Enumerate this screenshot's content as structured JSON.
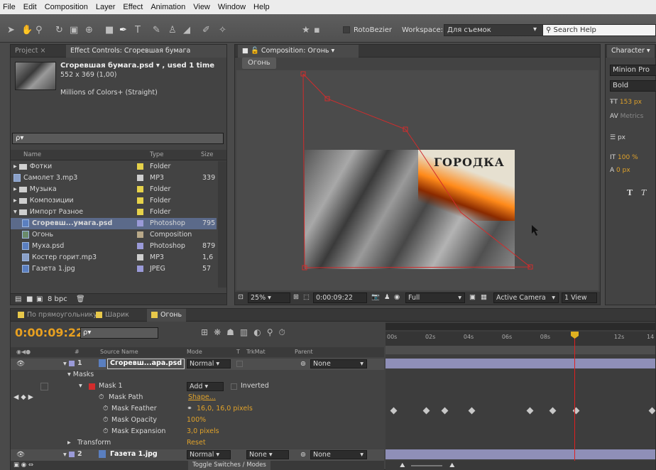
{
  "menu": [
    "File",
    "Edit",
    "Composition",
    "Layer",
    "Effect",
    "Animation",
    "View",
    "Window",
    "Help"
  ],
  "toolbar": {
    "rotobezier": "RotoBezier",
    "workspace_label": "Workspace:",
    "workspace_value": "Для съемок",
    "search_placeholder": "Search Help"
  },
  "project": {
    "tab_project": "Project",
    "tab_effects": "Effect Controls: Сгоревшая бумага",
    "asset_name": "Сгоревшая бумага.psd ▾ , used 1 time",
    "asset_dims": "552 x 369 (1,00)",
    "asset_colors": "Millions of Colors+ (Straight)",
    "search_placeholder": "ρ▾",
    "col_name": "Name",
    "col_type": "Type",
    "col_size": "Size",
    "rows": [
      {
        "name": "Фотки",
        "type": "Folder",
        "size": "",
        "icon": "folder",
        "swatch": "#e6d24a",
        "indent": 0
      },
      {
        "name": "Самолет 3.mp3",
        "type": "MP3",
        "size": "339",
        "icon": "audio",
        "swatch": "#cfcfcf",
        "indent": 0
      },
      {
        "name": "Музыка",
        "type": "Folder",
        "size": "",
        "icon": "folder",
        "swatch": "#e6d24a",
        "indent": 0
      },
      {
        "name": "Композиции",
        "type": "Folder",
        "size": "",
        "icon": "folder",
        "swatch": "#e6d24a",
        "indent": 0
      },
      {
        "name": "Импорт Разное",
        "type": "Folder",
        "size": "",
        "icon": "folder",
        "swatch": "#e6d24a",
        "indent": 0
      },
      {
        "name": "Сгоревш...умага.psd",
        "type": "Photoshop",
        "size": "795",
        "icon": "psd",
        "swatch": "#9a9ad8",
        "indent": 1
      },
      {
        "name": "Огонь",
        "type": "Composition",
        "size": "",
        "icon": "comp",
        "swatch": "#b8a888",
        "indent": 1
      },
      {
        "name": "Муха.psd",
        "type": "Photoshop",
        "size": "879",
        "icon": "psd",
        "swatch": "#9a9ad8",
        "indent": 1
      },
      {
        "name": "Костер горит.mp3",
        "type": "MP3",
        "size": "1,6",
        "icon": "audio",
        "swatch": "#cfcfcf",
        "indent": 1
      },
      {
        "name": "Газета 1.jpg",
        "type": "JPEG",
        "size": "57",
        "icon": "jpg",
        "swatch": "#9a9ad8",
        "indent": 1
      }
    ],
    "bpc": "8 bpc"
  },
  "comp": {
    "tab": "Composition: Огонь",
    "label": "Огонь",
    "image_text": "ГОРОДКА",
    "zoom": "25%",
    "timecode": "0:00:09:22",
    "resolution": "Full",
    "camera": "Active Camera",
    "views": "1 View"
  },
  "character": {
    "tab": "Character",
    "font": "Minion Pro",
    "style": "Bold",
    "size": "153 px",
    "metrics": "Metrics",
    "leading": "px",
    "scale": "100 %",
    "baseline": "0 px"
  },
  "timeline": {
    "tabs": [
      "По прямоугольнику",
      "Шарик",
      "Огонь"
    ],
    "timecode": "0:00:09:22",
    "search_placeholder": "ρ▾",
    "col_hash": "#",
    "col_source": "Source Name",
    "col_mode": "Mode",
    "col_t": "T",
    "col_trkmat": "TrkMat",
    "col_parent": "Parent",
    "layer1": {
      "num": "1",
      "name": "Сгоревш...ара.psd",
      "mode": "Normal",
      "parent": "None"
    },
    "masks": "Masks",
    "mask1": "Mask 1",
    "mask1_mode": "Add",
    "inverted": "Inverted",
    "mask_path": "Mask Path",
    "mask_path_val": "Shape...",
    "mask_feather": "Mask Feather",
    "mask_feather_val": "16,0, 16,0 pixels",
    "mask_opacity": "Mask Opacity",
    "mask_opacity_val": "100%",
    "mask_expansion": "Mask Expansion",
    "mask_expansion_val": "3,0 pixels",
    "transform": "Transform",
    "transform_val": "Reset",
    "layer2": {
      "num": "2",
      "name": "Газета 1.jpg",
      "mode": "Normal",
      "trkmat": "None",
      "parent": "None"
    },
    "toggle": "Toggle Switches / Modes",
    "ruler": [
      "00s",
      "02s",
      "04s",
      "06s",
      "08s",
      "12s",
      "14"
    ],
    "ruler_pos": [
      0,
      0.145,
      0.29,
      0.435,
      0.58,
      0.86,
      1.0
    ]
  },
  "colors": {
    "accent": "#e8a020",
    "mask": "#d22c2c",
    "playhead": "#e02020",
    "bar": "#8f8fb8"
  }
}
